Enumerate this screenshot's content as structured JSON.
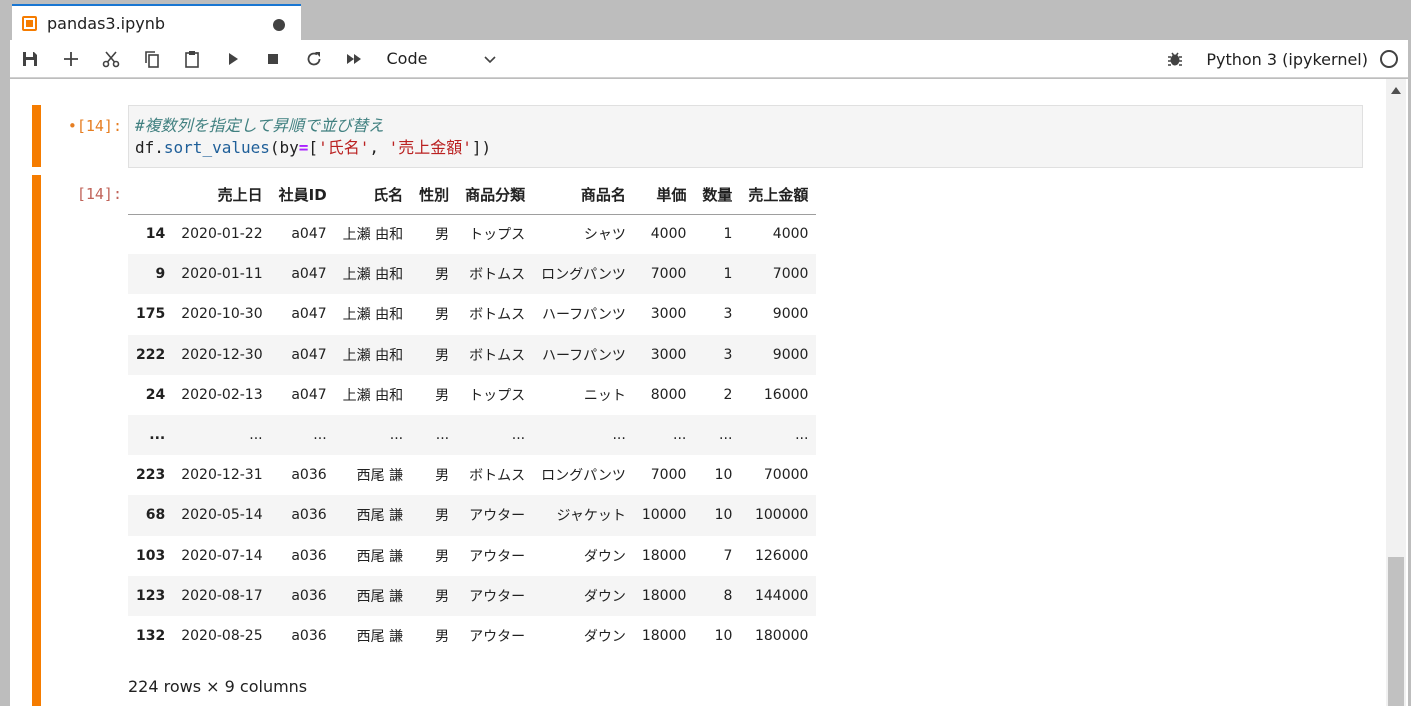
{
  "tab": {
    "title": "pandas3.ipynb"
  },
  "toolbar": {
    "cell_type": "Code",
    "kernel_name": "Python 3 (ipykernel)"
  },
  "cells": {
    "input_prompt": "•[14]:",
    "output_prompt": "[14]:",
    "code": {
      "comment": "#複数列を指定して昇順で並び替え",
      "line2_prefix": "df.",
      "line2_fn": "sort_values",
      "line2_open": "(by",
      "line2_eq": "=",
      "line2_bracket_open": "[",
      "line2_str1": "'氏名'",
      "line2_comma": ", ",
      "line2_str2": "'売上金額'",
      "line2_close": "])"
    }
  },
  "dataframe": {
    "columns": [
      "",
      "売上日",
      "社員ID",
      "氏名",
      "性別",
      "商品分類",
      "商品名",
      "単価",
      "数量",
      "売上金額"
    ],
    "rows": [
      [
        "14",
        "2020-01-22",
        "a047",
        "上瀬 由和",
        "男",
        "トップス",
        "シャツ",
        "4000",
        "1",
        "4000"
      ],
      [
        "9",
        "2020-01-11",
        "a047",
        "上瀬 由和",
        "男",
        "ボトムス",
        "ロングパンツ",
        "7000",
        "1",
        "7000"
      ],
      [
        "175",
        "2020-10-30",
        "a047",
        "上瀬 由和",
        "男",
        "ボトムス",
        "ハーフパンツ",
        "3000",
        "3",
        "9000"
      ],
      [
        "222",
        "2020-12-30",
        "a047",
        "上瀬 由和",
        "男",
        "ボトムス",
        "ハーフパンツ",
        "3000",
        "3",
        "9000"
      ],
      [
        "24",
        "2020-02-13",
        "a047",
        "上瀬 由和",
        "男",
        "トップス",
        "ニット",
        "8000",
        "2",
        "16000"
      ],
      [
        "...",
        "...",
        "...",
        "...",
        "...",
        "...",
        "...",
        "...",
        "...",
        "..."
      ],
      [
        "223",
        "2020-12-31",
        "a036",
        "西尾 謙",
        "男",
        "ボトムス",
        "ロングパンツ",
        "7000",
        "10",
        "70000"
      ],
      [
        "68",
        "2020-05-14",
        "a036",
        "西尾 謙",
        "男",
        "アウター",
        "ジャケット",
        "10000",
        "10",
        "100000"
      ],
      [
        "103",
        "2020-07-14",
        "a036",
        "西尾 謙",
        "男",
        "アウター",
        "ダウン",
        "18000",
        "7",
        "126000"
      ],
      [
        "123",
        "2020-08-17",
        "a036",
        "西尾 謙",
        "男",
        "アウター",
        "ダウン",
        "18000",
        "8",
        "144000"
      ],
      [
        "132",
        "2020-08-25",
        "a036",
        "西尾 謙",
        "男",
        "アウター",
        "ダウン",
        "18000",
        "10",
        "180000"
      ]
    ],
    "row_info": "224 rows × 9 columns"
  },
  "colors": {
    "accent": "#f57c00",
    "tab_top": "#1976d2"
  }
}
